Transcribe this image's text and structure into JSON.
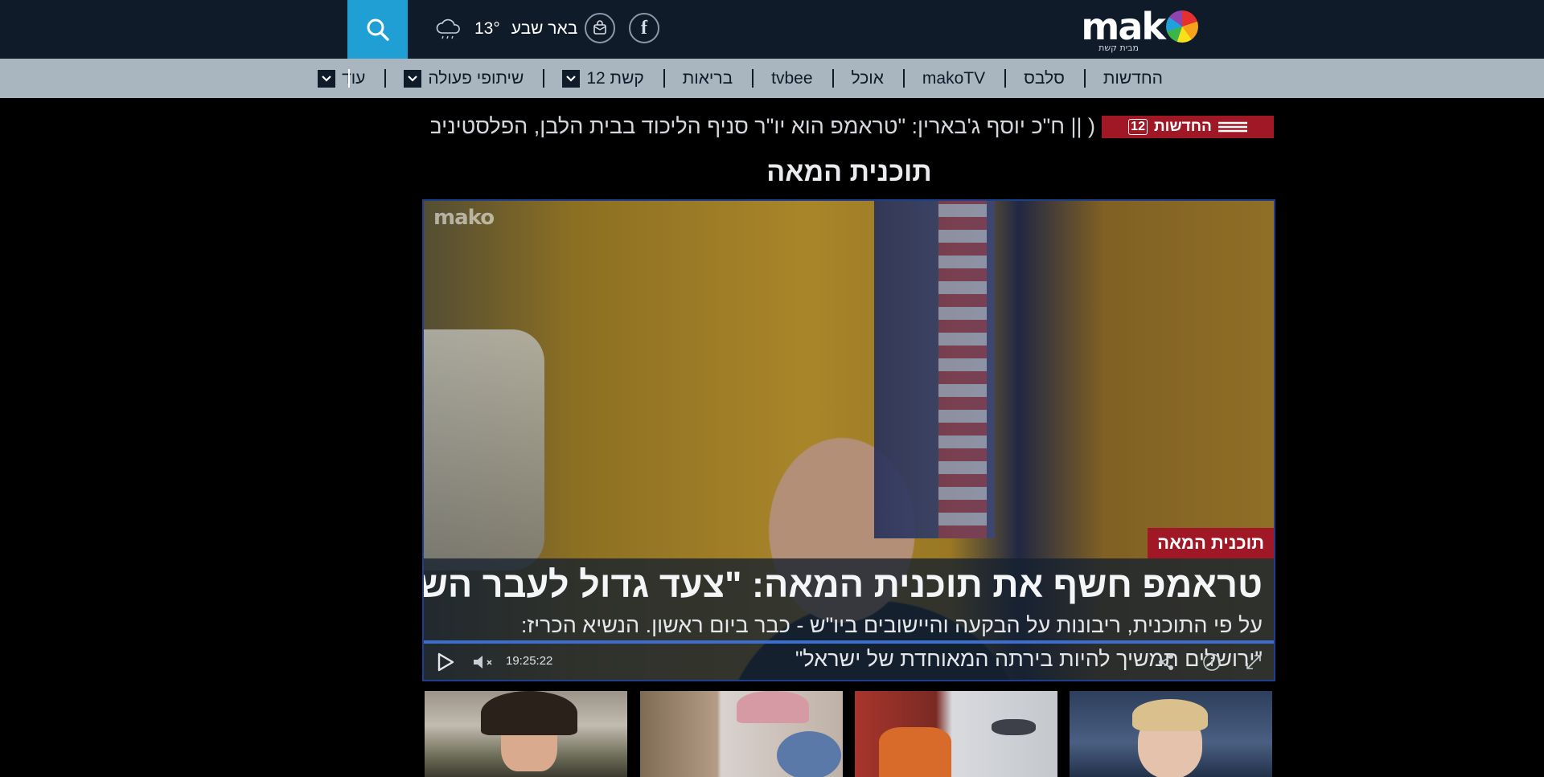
{
  "header": {
    "logo_text": "mako",
    "logo_subtitle": "מבית קשת",
    "weather": {
      "city": "באר שבע",
      "temperature": "13°",
      "icon": "cloud-rain-icon"
    },
    "social": [
      {
        "icon": "facebook-icon",
        "label": "f"
      },
      {
        "icon": "mail-bag-icon"
      }
    ],
    "search": {
      "icon": "search-icon",
      "bg_color": "#1f9fd4"
    }
  },
  "nav": {
    "items": [
      {
        "label": "החדשות",
        "dropdown": false
      },
      {
        "label": "סלבס",
        "dropdown": false
      },
      {
        "label": "makoTV",
        "dropdown": false
      },
      {
        "label": "אוכל",
        "dropdown": false
      },
      {
        "label": "tvbee",
        "dropdown": false
      },
      {
        "label": "בריאות",
        "dropdown": false
      },
      {
        "label": "קשת 12",
        "dropdown": true
      },
      {
        "label": "שיתופי פעולה",
        "dropdown": true
      },
      {
        "label": "עוד",
        "dropdown": true
      }
    ]
  },
  "ticker": {
    "badge": "החדשות",
    "badge_number": "12",
    "text": "(  || ח\"כ יוסף ג'בארין: \"טראמפ הוא יו\"ר סניף הליכוד בבית הלבן, הפלסטינים לא יסכ"
  },
  "section": {
    "title": "תוכנית המאה"
  },
  "player": {
    "watermark": "mako",
    "tag": "תוכנית המאה",
    "headline": "טראמפ חשף את תוכנית המאה: \"צעד גדול לעבר השלום\"",
    "subline": "על פי התוכנית, ריבונות על הבקעה והיישובים ביו\"ש - כבר ביום ראשון. הנשיא הכריז: \"ירושלים תמשיך להיות בירתה המאוחדת של ישראל\"",
    "timecode": "19:25:22",
    "muted": true,
    "accent_color": "#a01826"
  }
}
